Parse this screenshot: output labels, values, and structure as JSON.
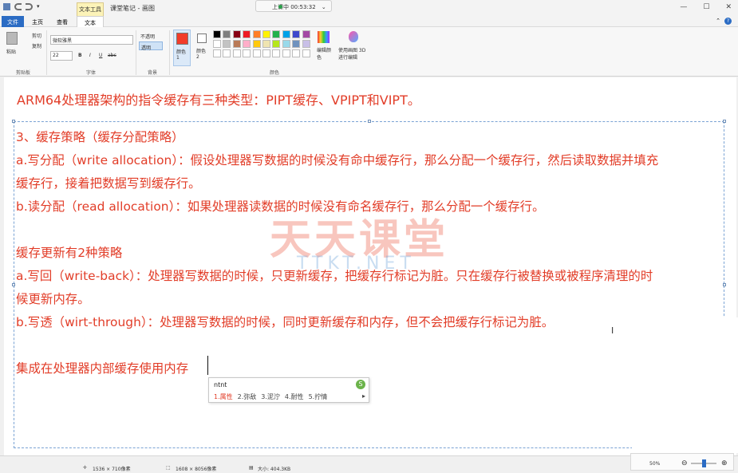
{
  "app": {
    "title": "课堂笔记 - 画图",
    "context_tab": "文本工具",
    "live_status": "上课中 00:53:32",
    "window_buttons": [
      "—",
      "☐",
      "✕"
    ]
  },
  "tabs": [
    {
      "label": "文件"
    },
    {
      "label": "主页"
    },
    {
      "label": "查看"
    },
    {
      "label": "文本"
    }
  ],
  "ribbon": {
    "clipboard": {
      "paste": "粘贴",
      "cut": "剪切",
      "copy": "复制",
      "label": "剪贴板"
    },
    "font": {
      "family": "微软雅黑",
      "size": "22",
      "bold": "B",
      "italic": "I",
      "underline": "U",
      "strike": "abc",
      "label": "字体"
    },
    "background": {
      "opaque": "不透明",
      "transparent": "透明",
      "label": "背景"
    },
    "colors": {
      "color1": "颜色 1",
      "color2": "颜色 2",
      "edit_colors": "编辑颜色",
      "paint3d": "使用画图 3D 进行编辑",
      "label": "颜色",
      "color1_value": "#f23c2a",
      "color2_value": "#ffffff",
      "palette": [
        "#000000",
        "#7f7f7f",
        "#880015",
        "#ed1c24",
        "#ff7f27",
        "#fff200",
        "#22b14c",
        "#00a2e8",
        "#3f48cc",
        "#a349a4",
        "#ffffff",
        "#c3c3c3",
        "#b97a57",
        "#ffaec9",
        "#ffc90e",
        "#efe4b0",
        "#b5e61d",
        "#99d9ea",
        "#7092be",
        "#c8bfe7"
      ]
    }
  },
  "canvas": {
    "heading": "ARM64处理器架构的指令缓存有三种类型：PIPT缓存、VPIPT和VIPT。",
    "lines": [
      "3、缓存策略（缓存分配策略）",
      "a.写分配（write allocation）：假设处理器写数据的时候没有命中缓存行，那么分配一个缓存行，然后读取数据并填充",
      "缓存行，接着把数据写到缓存行。",
      "b.读分配（read allocation）：如果处理器读数据的时候没有命名缓存行，那么分配一个缓存行。",
      "缓存更新有2种策略",
      "a.写回（write-back）：处理器写数据的时候，只更新缓存，把缓存行标记为脏。只在缓存行被替换或被程序清理的时",
      "候更新内存。",
      "b.写透（wirt-through）：处理器写数据的时候，同时更新缓存和内存，但不会把缓存行标记为脏。",
      "集成在处理器内部缓存使用内存"
    ],
    "watermark": "天天课堂",
    "watermark_sub": "TTKT.NET"
  },
  "ime": {
    "input": "ntnt",
    "candidates": [
      "1.属性",
      "2.弥敌",
      "3.泥泞",
      "4.耐性",
      "5.拧情"
    ],
    "more": "▸"
  },
  "status": {
    "cursor": "1536 × 710像素",
    "selection": "1608 × 8056像素",
    "size": "大小: 404.3KB",
    "zoom": "50%",
    "zoom_level": 0.5
  }
}
